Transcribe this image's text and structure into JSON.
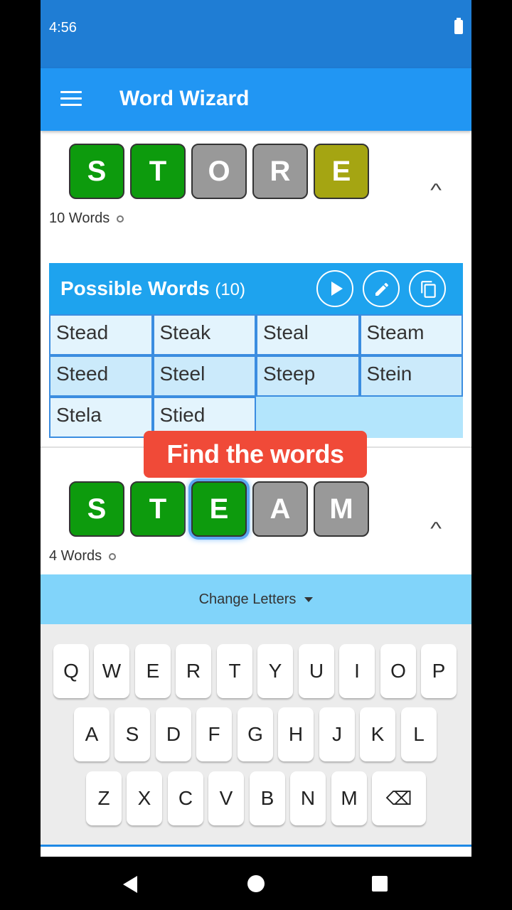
{
  "status": {
    "time": "4:56"
  },
  "appbar": {
    "title": "Word Wizard",
    "menu_icon": "hamburger-menu-icon"
  },
  "guess1": {
    "letters": [
      "S",
      "T",
      "O",
      "R",
      "E"
    ],
    "states": [
      "green",
      "green",
      "gray",
      "gray",
      "yellow"
    ],
    "word_count": "10 Words",
    "collapse_icon": "^"
  },
  "possible_words": {
    "title": "Possible Words",
    "count": "(10)",
    "words": [
      "Stead",
      "Steak",
      "Steal",
      "Steam",
      "Steed",
      "Steel",
      "Steep",
      "Stein",
      "Stela",
      "Stied"
    ],
    "icons": [
      "play-icon",
      "pencil-icon",
      "copy-icon"
    ]
  },
  "toast": {
    "text": "Find the words"
  },
  "guess2": {
    "letters": [
      "S",
      "T",
      "E",
      "A",
      "M"
    ],
    "states": [
      "green",
      "green",
      "green",
      "gray",
      "gray"
    ],
    "word_count": "4 Words",
    "collapse_icon": "^"
  },
  "change_letters": {
    "label": "Change Letters"
  },
  "keyboard": {
    "row1": [
      "Q",
      "W",
      "E",
      "R",
      "T",
      "Y",
      "U",
      "I",
      "O",
      "P"
    ],
    "row2": [
      "A",
      "S",
      "D",
      "F",
      "G",
      "H",
      "J",
      "K",
      "L"
    ],
    "row3": [
      "Z",
      "X",
      "C",
      "V",
      "B",
      "N",
      "M"
    ],
    "backspace": "⌫"
  },
  "colors": {
    "green": "#0d9b0d",
    "gray": "#999999",
    "yellow": "#a5a512",
    "appbar": "#2196f3",
    "toast": "#f04a38"
  }
}
